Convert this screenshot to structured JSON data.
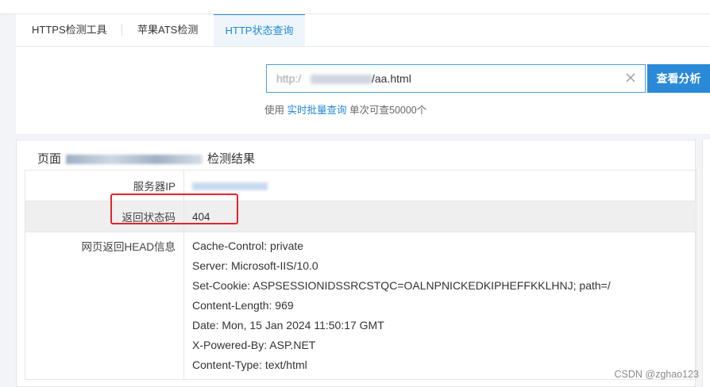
{
  "tabs": [
    {
      "label": "HTTPS检测工具",
      "active": false
    },
    {
      "label": "苹果ATS检测",
      "active": false
    },
    {
      "label": "HTTP状态查询",
      "active": true
    }
  ],
  "search": {
    "url_prefix": "http:/",
    "url_suffix": "/aa.html",
    "button_label": "查看分析",
    "hint_prefix": "使用",
    "hint_link": "实时批量查询",
    "hint_suffix": "单次可查50000个"
  },
  "result": {
    "title_prefix": "页面",
    "title_suffix": "检测结果",
    "rows": [
      {
        "key": "服务器IP"
      },
      {
        "key": "返回状态码",
        "value": "404"
      },
      {
        "key": "网页返回HEAD信息"
      }
    ],
    "head_lines": [
      "Cache-Control: private",
      "Server: Microsoft-IIS/10.0",
      "Set-Cookie: ASPSESSIONIDSSRCSTQC=OALNPNICKEDKIPHEFFKKLHNJ; path=/",
      "Content-Length: 969",
      "Date: Mon, 15 Jan 2024 11:50:17 GMT",
      "X-Powered-By: ASP.NET",
      "Content-Type: text/html"
    ]
  },
  "watermark": "CSDN @zghao123",
  "colors": {
    "accent": "#2a8ad8",
    "highlight": "#e8222a"
  }
}
